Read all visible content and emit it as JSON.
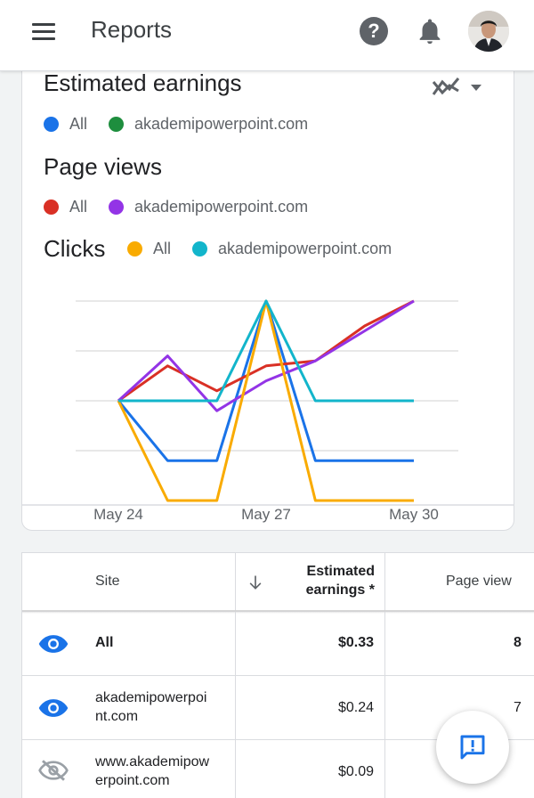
{
  "appbar": {
    "title": "Reports",
    "menu_icon": "menu-icon",
    "help_icon": "help-icon",
    "help_glyph": "?",
    "notification_icon": "bell-icon",
    "avatar": "user-avatar"
  },
  "chart_section": {
    "earnings_title": "Estimated earnings",
    "page_views_title": "Page views",
    "clicks_title": "Clicks",
    "chart_type_icon": "line-chart-compare-icon",
    "earnings_legend": [
      {
        "label": "All",
        "color": "#1a73e8"
      },
      {
        "label": "akademipowerpoint.com",
        "color": "#1e8e3e"
      }
    ],
    "page_views_legend": [
      {
        "label": "All",
        "color": "#d93025"
      },
      {
        "label": "akademipowerpoint.com",
        "color": "#9334e6"
      }
    ],
    "clicks_legend": [
      {
        "label": "All",
        "color": "#f9ab00"
      },
      {
        "label": "akademipowerpoint.com",
        "color": "#12b5cb"
      }
    ]
  },
  "chart_data": {
    "type": "line",
    "x": [
      "May 24",
      "May 25",
      "May 26",
      "May 27",
      "May 28",
      "May 29",
      "May 30"
    ],
    "x_tick_labels": [
      "May 24",
      "May 27",
      "May 30"
    ],
    "grid": true,
    "legend": "top",
    "series": [
      {
        "name": "All",
        "metric": "Estimated earnings",
        "color": "#1a73e8",
        "values": [
          2,
          0.8,
          0.8,
          4,
          0.8,
          0.8,
          0.8
        ]
      },
      {
        "name": "All",
        "metric": "Page views",
        "color": "#d93025",
        "values": [
          2,
          2.7,
          2.2,
          2.7,
          2.8,
          3.5,
          4
        ]
      },
      {
        "name": "akademipowerpoint.com",
        "metric": "Page views",
        "color": "#9334e6",
        "values": [
          2,
          2.9,
          1.8,
          2.4,
          2.8,
          3.4,
          4
        ]
      },
      {
        "name": "All",
        "metric": "Clicks",
        "color": "#f9ab00",
        "values": [
          2,
          0,
          0,
          4,
          0,
          0,
          0
        ]
      },
      {
        "name": "akademipowerpoint.com",
        "metric": "Clicks",
        "color": "#12b5cb",
        "values": [
          2,
          2,
          2,
          4,
          2,
          2,
          2
        ]
      }
    ]
  },
  "table": {
    "headers": {
      "site": "Site",
      "sort_icon": "arrow-down-icon",
      "earnings_line1": "Estimated",
      "earnings_line2": "earnings *",
      "page_views": "Page view"
    },
    "rows": [
      {
        "visibility_icon": "eye-icon",
        "site_line1": "All",
        "site_line2": "",
        "earnings": "$0.33",
        "page_views": "8"
      },
      {
        "visibility_icon": "eye-icon",
        "site_line1": "akademipowerpoi",
        "site_line2": "nt.com",
        "earnings": "$0.24",
        "page_views": "7"
      },
      {
        "visibility_icon": "eye-off-icon",
        "site_line1": "www.akademipow",
        "site_line2": "erpoint.com",
        "earnings": "$0.09",
        "page_views": ""
      }
    ]
  },
  "fab": {
    "icon": "feedback-icon"
  }
}
